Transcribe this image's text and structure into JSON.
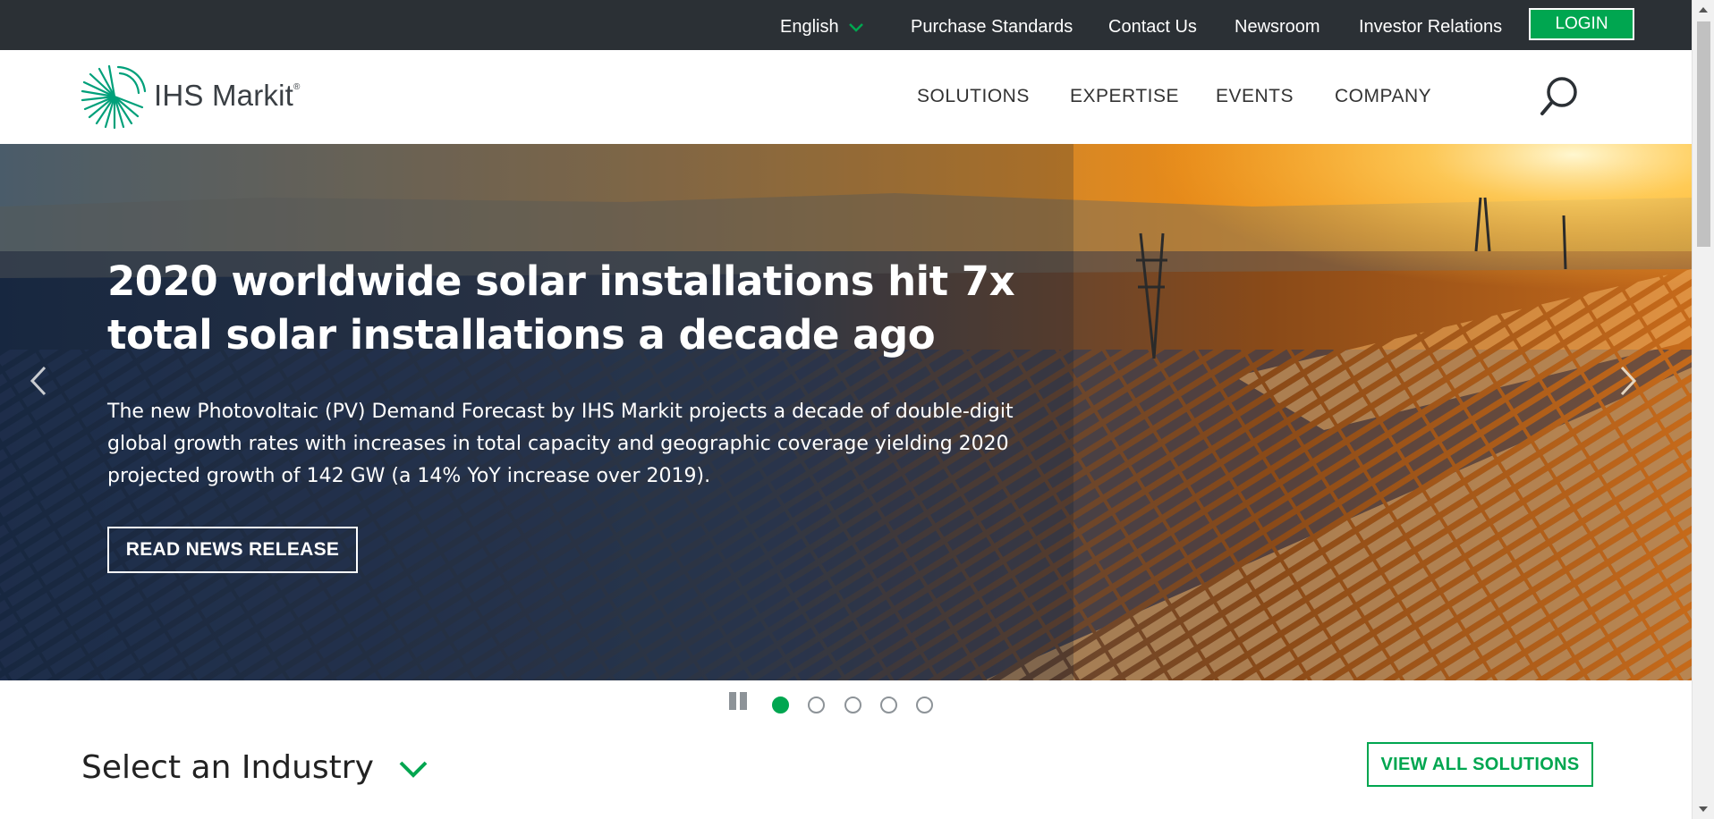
{
  "utility_nav": {
    "language": "English",
    "links": [
      "Purchase Standards",
      "Contact Us",
      "Newsroom",
      "Investor Relations"
    ],
    "login_label": "LOGIN"
  },
  "header": {
    "logo_text": "IHS Markit",
    "logo_mark": "®",
    "nav_items": [
      "SOLUTIONS",
      "EXPERTISE",
      "EVENTS",
      "COMPANY"
    ],
    "search_icon": "search-icon"
  },
  "hero": {
    "title": "2020 worldwide solar installations hit 7x total solar installations a decade ago",
    "description": "The new Photovoltaic (PV) Demand Forecast by IHS Markit projects a decade of double-digit global growth rates with increases in total capacity and geographic coverage yielding 2020 projected growth of 142 GW (a 14% YoY increase over 2019).",
    "cta_label": "READ NEWS RELEASE"
  },
  "carousel": {
    "slide_count": 5,
    "active_index": 0
  },
  "industry": {
    "label": "Select an Industry",
    "view_all_label": "VIEW ALL SOLUTIONS"
  },
  "colors": {
    "accent": "#00a650",
    "utility_bar": "#2b3035",
    "text": "#333333"
  }
}
